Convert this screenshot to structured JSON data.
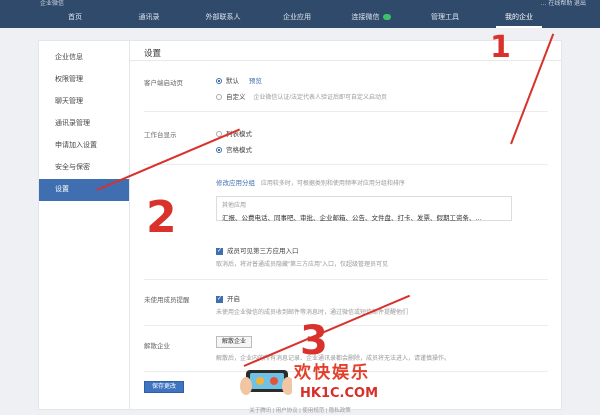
{
  "topbar": {
    "logo": "企业微信",
    "links": "…  在线帮助  退出"
  },
  "nav": {
    "items": [
      "首页",
      "通讯录",
      "外部联系人",
      "企业应用",
      "连接微信",
      "管理工具",
      "我的企业"
    ]
  },
  "sidebar": {
    "items": [
      "企业信息",
      "权限管理",
      "聊天管理",
      "通讯录管理",
      "申请加入设置",
      "安全与保密",
      "设置"
    ]
  },
  "main": {
    "title": "设置",
    "client_page": {
      "label": "客户端启动页",
      "opt1": "默认",
      "opt1_link": "预览",
      "opt2": "自定义",
      "opt2_hint": "企业微信认证/法定代表人验证后即可自定义启动页"
    },
    "workbench": {
      "label": "工作台显示",
      "opt1": "列表模式",
      "opt2": "宫格模式"
    },
    "group": {
      "link": "修改应用分组",
      "hint": "应用较多时，可根据类别和使用频率对应用分组和排序",
      "box_title": "其他应用",
      "box_items": "汇报、公费电话、同事吧、审批、企业邮箱、公告、文件盘、打卡、发票、假期工资条、…"
    },
    "third_party": {
      "label": "成员可见第三方应用入口",
      "hint": "取消后，将对普通成员隐藏“第三方应用”入口，仅超级管理员可见"
    },
    "unused": {
      "label": "未使用成员提醒",
      "check": "开启",
      "hint": "未使用企业微信的成员收到邮件等消息时，通过微信或短信邮件提醒他们"
    },
    "dissolve": {
      "label": "解散企业",
      "button": "解散企业",
      "hint": "解散后，企业内的所有消息记录、企业通讯录都会删除，成员将无法进入，请谨慎操作。"
    },
    "save": "保存更改"
  },
  "footer": "关于腾讯 | 用户协议 | 使用规范 | 隐私政策",
  "annotations": {
    "num1": "1",
    "num2": "2",
    "num3": "3"
  },
  "watermark": {
    "cn": "欢快娱乐",
    "en": "HK1C.COM"
  },
  "colors": {
    "nav": "#2f4a6b",
    "accent": "#3f6fb0",
    "annotation": "#d9312b"
  }
}
